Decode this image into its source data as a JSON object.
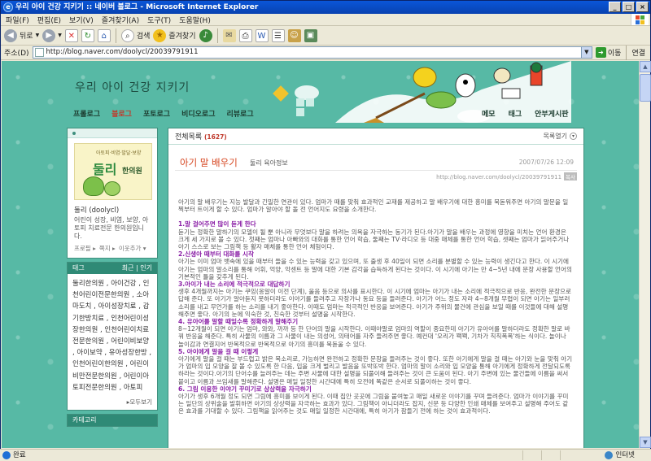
{
  "window": {
    "title": "우리 아이 건강 지키기 :: 네이버 블로그 - Microsoft Internet Explorer",
    "icon": "ie-icon"
  },
  "menu": [
    "파일(F)",
    "편집(E)",
    "보기(V)",
    "즐겨찾기(A)",
    "도구(T)",
    "도움말(H)"
  ],
  "toolbar": {
    "back": "뒤로",
    "search": "검색",
    "favorites": "즐겨찾기"
  },
  "address": {
    "label": "주소(D)",
    "url": "http://blog.naver.com/doolycl/20039791911",
    "go": "이동",
    "links": "연결"
  },
  "blog": {
    "title": "우리 아이 건강 지키기",
    "nav_left": [
      "프롤로그",
      "블로그",
      "포토로그",
      "비디오로그",
      "리뷰로그"
    ],
    "nav_right": [
      "메모",
      "태그",
      "안부게시판"
    ],
    "active_nav": "블로그"
  },
  "sidebar": {
    "profile_small_text": "아토피·비염·발달·보양",
    "profile_brand": "둘리",
    "profile_brand2": "한의원",
    "nickname": "둘리 (doolycl)",
    "description": "어린이 성장, 비염, 보양, 아토피 치료전문 한의원입니다.",
    "links": [
      "프로필 ▸",
      "쪽지 ▸",
      "이웃추가 ▾"
    ],
    "tag_bar_label": "태그",
    "tag_bar_right": "최근 | 인기",
    "tags_text": "둘리한의원 , 아이건강 , 인천어린이전문한의원 , 소아마도치 , 아이성장치료 , 감기한방치료 , 인천어린이성장한의원 , 인천어린이치료전문한의원 , 어린이비보양 , 아이보약 , 유아성장한방 , 인천어린이한의원 , 어린이비만전문한의원 , 어린이아토피전문한의원 , 아토피",
    "more": "▸모두보기",
    "category_label": "카테고리"
  },
  "main": {
    "list_label": "전체목록",
    "list_count": "(1627)",
    "list_toggle": "목록열기",
    "post_title": "아기 말 배우기",
    "post_category": "둘리 육아정보",
    "post_date": "2007/07/26 12:09",
    "post_url": "http://blog.naver.com/doolycl/20039791911",
    "post_url_tag": "복사",
    "content": {
      "intro": "아기의 말 배우기는 지능 발달과 긴밀한 연관이 있다. 엄마가 때를 맞춰 효과적인 교재를 제공하고 말 배우기에 대한 흥미를 북돋워주면 아기의 말문을 일찍부터 트이게 할 수 있다. 엄마가 알아야 할 돌 전 언어지도 요령을 소개한다.",
      "h1": "1.말 걸어주면 많이 듣게 한다",
      "b1": "듣기는 정확한 말하기의 모델이 될 뿐 아니라 무엇보다 말을 하려는 의욕을 자극하는 동기가 된다.아기가 말을 배우는 과정에 영향을 미치는 언어 환경은 크게 세 가지로 볼 수 있다. 첫째는 엄마나 아빠와의 대화를 통한 언어 학습, 둘째는 TV·라디오 등 대중 매체를 통한 언어 학습, 셋째는 엄마가 읽어주거나 아기 스스로 보는 그림책 등 활자 매체를 통한 언어 체험이다.",
      "h2": "2.신생아 때부터 대화를 시작",
      "b2": "아기는 이미 엄마 뱃속에 있을 때부터 들을 수 있는 능력을 갖고 있으며, 또 출생 후 40일이 되면 소리를 분별할 수 있는 능력이 생긴다고 한다. 이 시기에 아기는 엄마의 말소리를 통해 어휘, 억양, 악센트 등 말에 대한 기본 감각을 습득하게 된다는 것이다. 이 시기에 아기는 만 4~5년 내에 문장 사용할 언어의 기본적인 틀을 갖추게 된다.",
      "h3": "3.아이가 내는 소리에 적극적으로 대답하기",
      "b3": "생후 4개월까지는 아기는 쿠잉(옹알이 이전 단계), 울음 등으로 의사를 표시한다. 이 시기에 엄마는 아기가 내는 소리에 적극적으로 반응, 완전한 문장으로 답해 준다. 또 아기가 알아듣지 못하더라도 이야기를 들려주고 자장가나 동요 등을 들려준다. 아기가 어느 정도 자라 4~8개월 무렵이 되면 아기는 일부러 소리를 내고 무언가를 하는 소리를 내기 좋아한다. 이때도 엄마는 적극적인 반응을 보여준다. 아기가 주위의 물건에 관심을 보일 때를 이것들에 대해 설명해주면 좋다. 아기의 눈에 익숙한 것, 친숙한 것부터 설명을 시작한다.",
      "h4": "4. 유아어를 말할 때일수록 정확하게 말해주기",
      "b4": "8~12개월이 되면 아기는 엄마, 와와, 까까 등 한 단어의 말을 시작한다. 이때야말로 엄마의 역할이 중요한데 아기가 유아어를 말하더라도 정확한 말로 바꿔 반응을 해준다. 특히 사물의 이름과 그 사물이 내는 의성어, 의태어를 자주 들려주면 좋다. 예컨대 '오리가 꽥꽥, 기차가 칙칙폭폭'하는 식이다. 놀이나 놀이감과 연결지어 반복적으로 반복적으로 아기의 흥미를 북돋울 수 있다.",
      "h5": "5. 아이에게 말을 걸 때 이렇게",
      "b5": "아기에게 말을 걸 때는 부드럽고 밝은 목소리로, 가능하면 완전하고 정확한 문장을 들려주는 것이 좋다. 또한 아기에게 말을 걸 때는 아기와 눈을 맞춰 아기가 엄마의 입 모양을 잘 볼 수 있도록 한 다음, 입을 크게 벌리고 발음을 또박또박 한다. 엄마의 말이 소리와 입 모양을 통해 아기에게 정확하게 전달되도록 하라는 것이다.아기의 단어수를 늘려주는 데는 주변 사물에 대한 설명을 되풀이해 들려주는 것이 큰 도움이 된다. 아기 주변에 있는 물건들에 이름을 써서 붙이고 이름과 쓰임새를 말해준다. 설명은 매일 일정한 시간대에 특히 오전에 똑같은 순서로 되풀이하는 것이 좋다.",
      "h6": "6. 그림 이용한 이야기 꾸미기로 상상력을 자극하기",
      "b6": "아기가 생후 6개월 정도 되면 그림에 흥미를 보이게 된다. 이때 집안 곳곳에 그림을 붙여놓고 매일 새로운 이야기를 꾸며 들려준다. 엄마가 이야기를 꾸미는 일단의 상위술을 발휘하면 아기의 상상력을 자극하는 효과가 있다. 그림책이 아니더라도 잡지, 신문 등 다양한 인쇄 매체를 보여주고 설명해 주어도 같은 효과를 기대할 수 있다. 그림책을 읽어주는 것도 매일 일정한 시간대에, 특히 아기가 잠들기 전에 하는 것이 효과적이다."
    }
  },
  "status": {
    "left": "완료",
    "zone": "인터넷"
  }
}
